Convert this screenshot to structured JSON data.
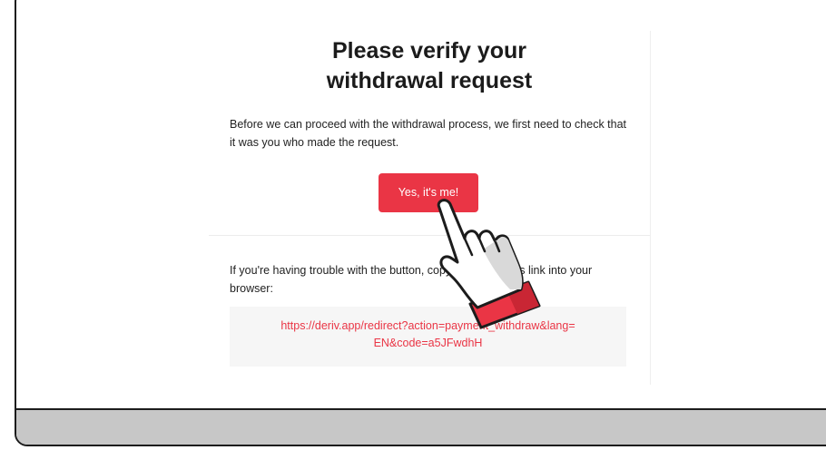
{
  "email": {
    "title_line1": "Please verify your",
    "title_line2": "withdrawal request",
    "intro": "Before we can proceed with the withdrawal process, we first need to check that it was you who made the request.",
    "verify_button": "Yes, it's me!",
    "trouble_text": "If you're having trouble with the button, copy and paste this link into your browser:",
    "link_line1": "https://deriv.app/redirect?action=payment_withdraw&lang=",
    "link_line2": "EN&code=a5JFwdhH"
  },
  "colors": {
    "accent": "#ea3545",
    "frame": "#1c1c1c",
    "frame_bottom": "#c7c7c7",
    "link_box_bg": "#f6f6f6"
  },
  "icons": {
    "pointer": "hand-pointer-icon"
  }
}
